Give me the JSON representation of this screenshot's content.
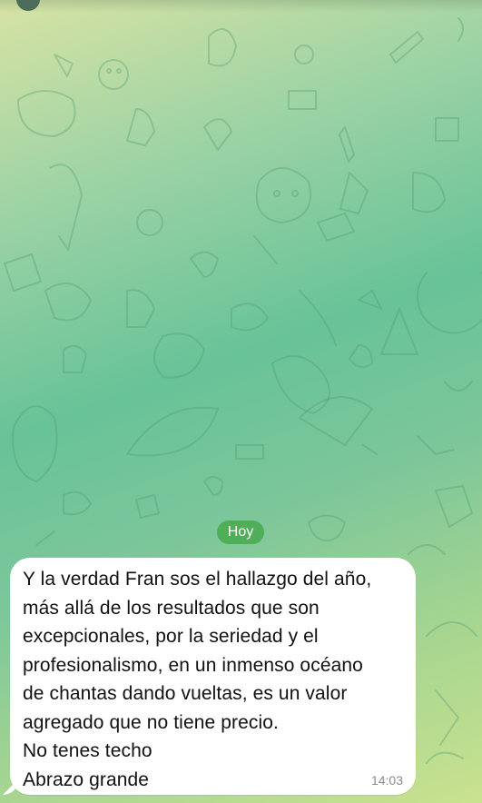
{
  "chat": {
    "date_separator": "Hoy",
    "message": {
      "lines": [
        "Y la verdad Fran sos el hallazgo del año,",
        "más allá de los resultados que son",
        "excepcionales, por la seriedad y el",
        "profesionalismo, en un inmenso océano",
        "de chantas dando vueltas, es un valor",
        "agregado que no tiene precio.",
        "No tenes techo",
        "Abrazo grande"
      ],
      "time": "14:03"
    }
  },
  "colors": {
    "date_pill": "#4fae58",
    "bubble": "#ffffff",
    "timestamp": "#8a8a8a"
  }
}
